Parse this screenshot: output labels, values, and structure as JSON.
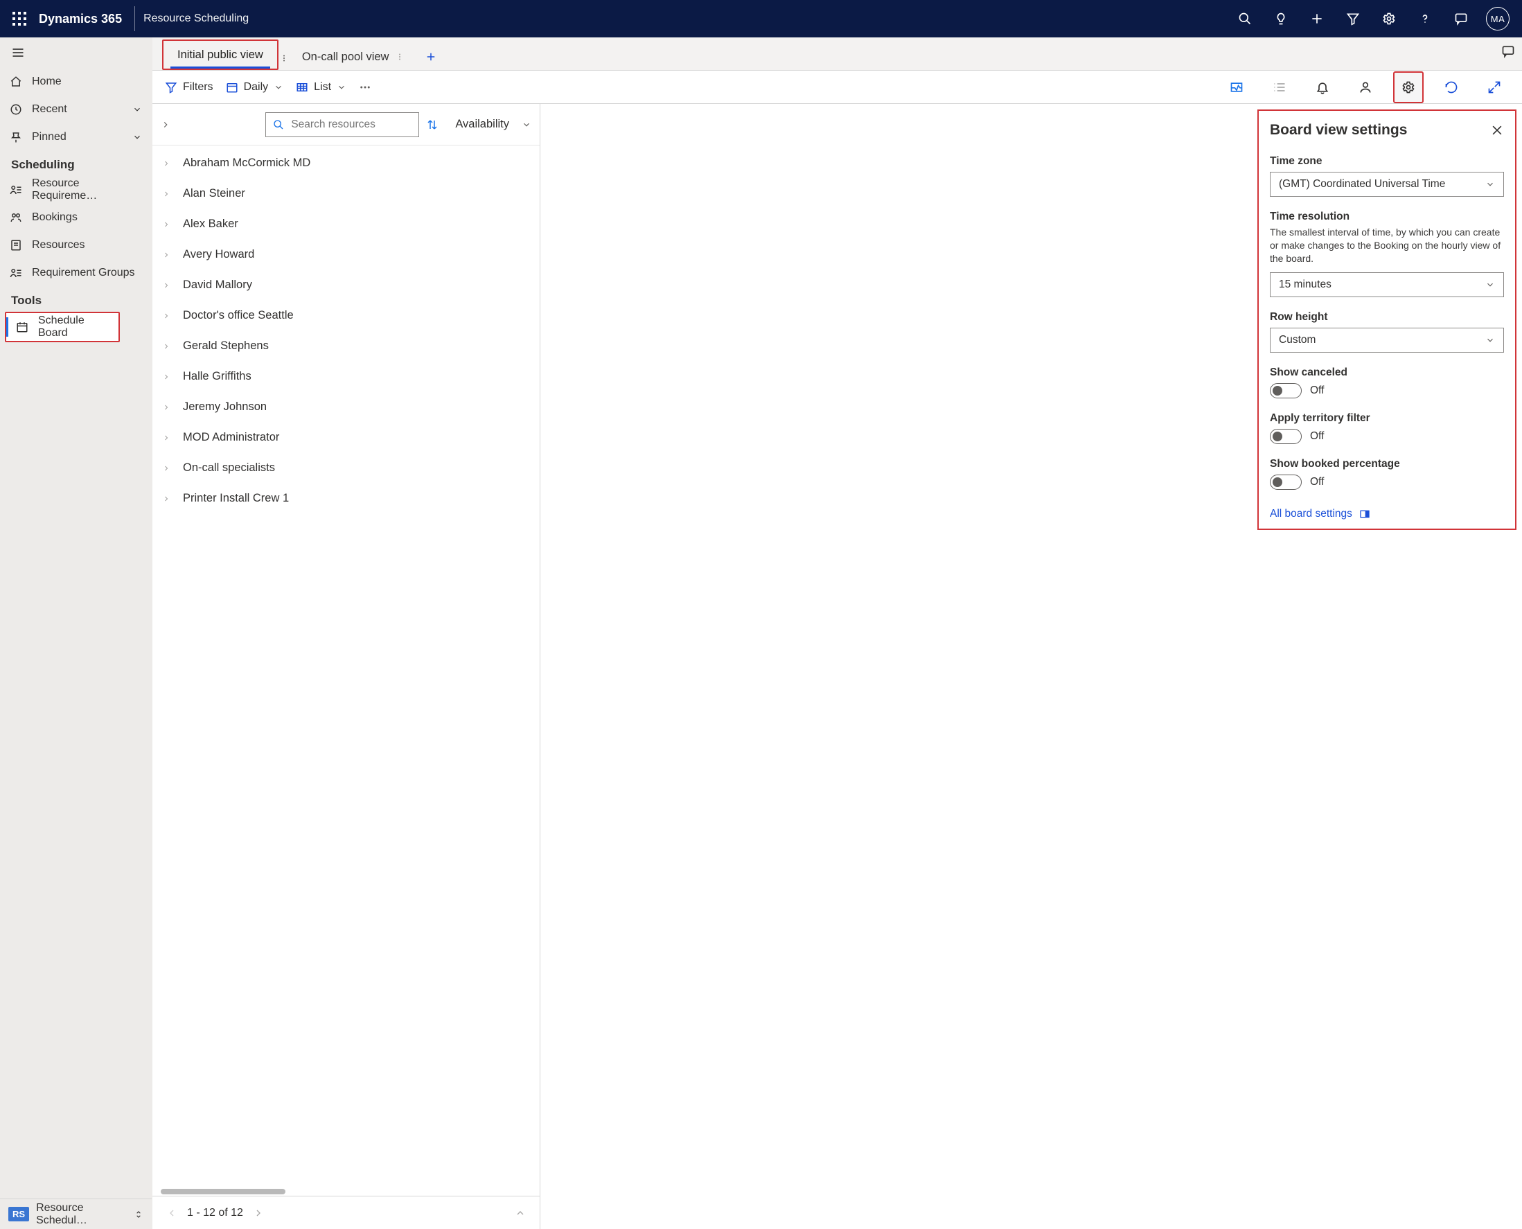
{
  "header": {
    "brand": "Dynamics 365",
    "module": "Resource Scheduling",
    "avatar": "MA"
  },
  "sidebar": {
    "items_main": [
      {
        "label": "Home"
      },
      {
        "label": "Recent"
      },
      {
        "label": "Pinned"
      }
    ],
    "section_scheduling": "Scheduling",
    "items_scheduling": [
      {
        "label": "Resource Requireme…"
      },
      {
        "label": "Bookings"
      },
      {
        "label": "Resources"
      },
      {
        "label": "Requirement Groups"
      }
    ],
    "section_tools": "Tools",
    "schedule_board": "Schedule Board",
    "footer_chip": "RS",
    "footer_label": "Resource Schedul…"
  },
  "tabs": {
    "initial": "Initial public view",
    "oncall": "On-call pool view"
  },
  "toolbar": {
    "filters": "Filters",
    "daily": "Daily",
    "list": "List"
  },
  "resources": {
    "search_placeholder": "Search resources",
    "sort_label": "Availability",
    "items": [
      "Abraham McCormick MD",
      "Alan Steiner",
      "Alex Baker",
      "Avery Howard",
      "David Mallory",
      "Doctor's office Seattle",
      "Gerald Stephens",
      "Halle Griffiths",
      "Jeremy Johnson",
      "MOD Administrator",
      "On-call specialists",
      "Printer Install Crew 1"
    ],
    "pager": "1 - 12 of 12"
  },
  "settings": {
    "title": "Board view settings",
    "timezone_label": "Time zone",
    "timezone_value": "(GMT) Coordinated Universal Time",
    "timeres_label": "Time resolution",
    "timeres_help": "The smallest interval of time, by which you can create or make changes to the Booking on the hourly view of the board.",
    "timeres_value": "15 minutes",
    "rowheight_label": "Row height",
    "rowheight_value": "Custom",
    "show_canceled": "Show canceled",
    "show_canceled_state": "Off",
    "territory": "Apply territory filter",
    "territory_state": "Off",
    "booked_pct": "Show booked percentage",
    "booked_pct_state": "Off",
    "all_link": "All board settings"
  }
}
